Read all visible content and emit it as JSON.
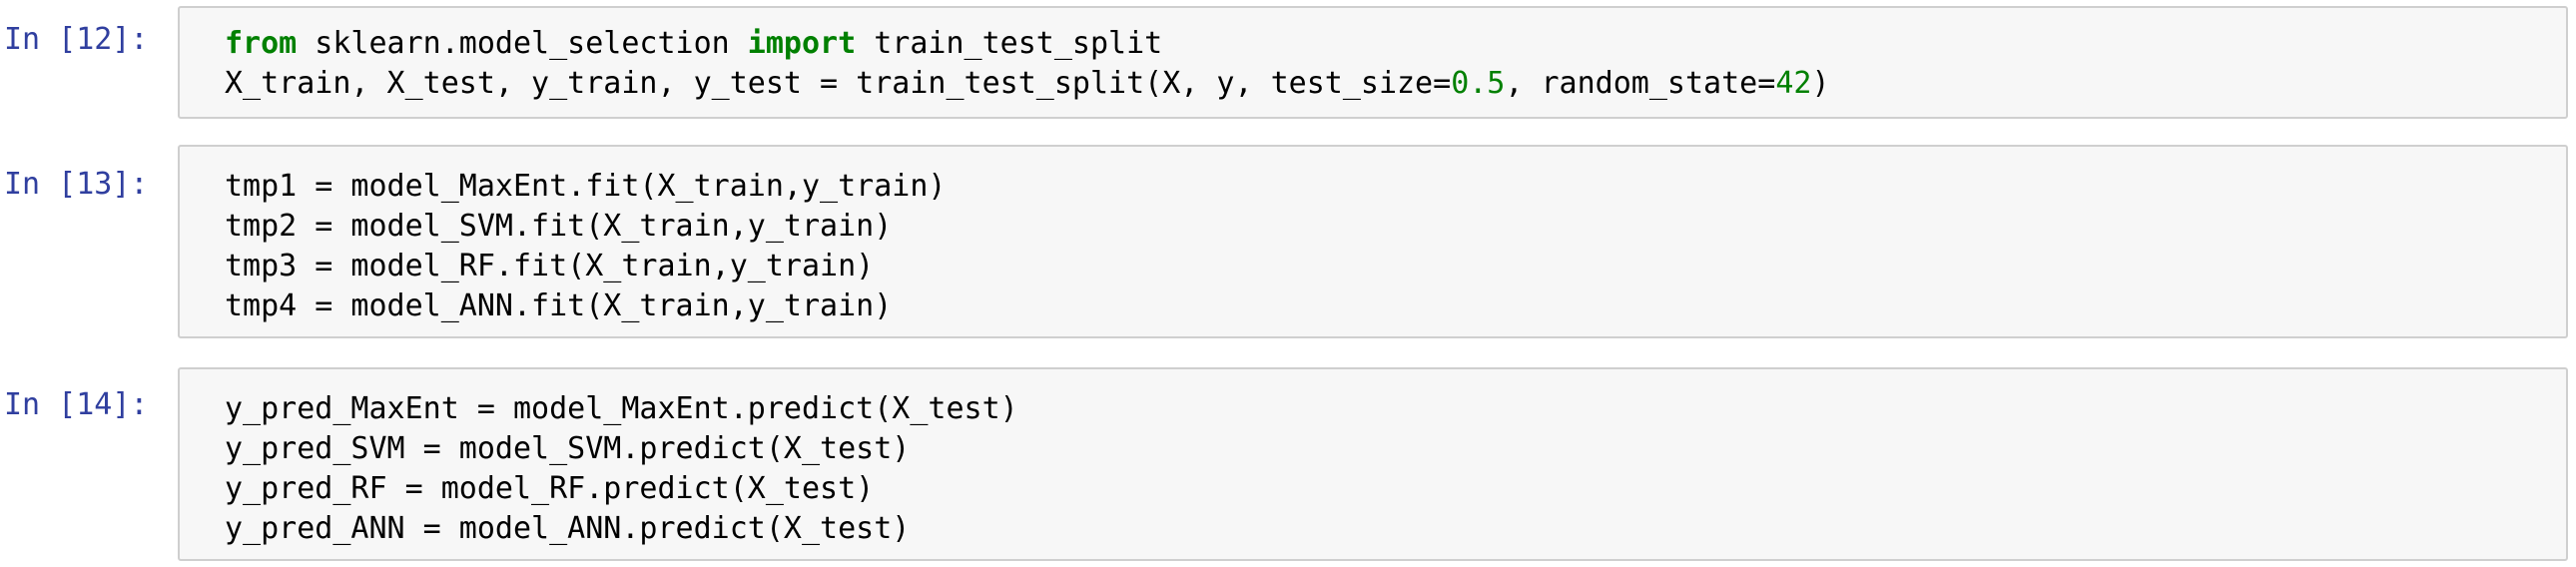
{
  "colors": {
    "prompt": "#303f9f",
    "keyword": "#008000",
    "number": "#008000",
    "cell_background": "#f7f7f7",
    "cell_border": "#cfcfcf"
  },
  "cells": [
    {
      "prompt": "In [12]:",
      "line1": {
        "kw1": "from",
        "t1": " sklearn.model_selection ",
        "kw2": "import",
        "t2": " train_test_split"
      },
      "line2": {
        "t1": "X_train, X_test, y_train, y_test = train_test_split(X, y, test_size=",
        "n1": "0.5",
        "t2": ", random_state=",
        "n2": "42",
        "t3": ")"
      }
    },
    {
      "prompt": "In [13]:",
      "lines": [
        "tmp1 = model_MaxEnt.fit(X_train,y_train)",
        "tmp2 = model_SVM.fit(X_train,y_train)",
        "tmp3 = model_RF.fit(X_train,y_train)",
        "tmp4 = model_ANN.fit(X_train,y_train)"
      ]
    },
    {
      "prompt": "In [14]:",
      "lines": [
        "y_pred_MaxEnt = model_MaxEnt.predict(X_test)",
        "y_pred_SVM = model_SVM.predict(X_test)",
        "y_pred_RF = model_RF.predict(X_test)",
        "y_pred_ANN = model_ANN.predict(X_test)"
      ]
    }
  ]
}
